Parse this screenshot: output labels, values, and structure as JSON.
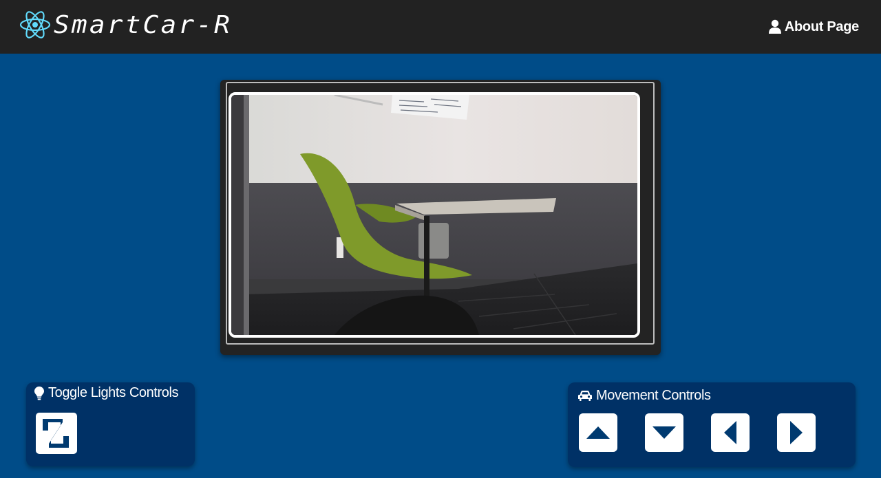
{
  "navbar": {
    "brand": "SmartCar-R",
    "about_label": "About Page",
    "brand_icon": "atom-icon",
    "about_icon": "user-icon"
  },
  "video": {
    "photo_icon": "camera-feed-image"
  },
  "lights": {
    "title": "Toggle Lights Controls",
    "title_icon": "lightbulb-icon",
    "button_icon": "z-logo-icon"
  },
  "movement": {
    "title": "Movement Controls",
    "title_icon": "car-icon",
    "buttons": [
      "forward",
      "backward",
      "left",
      "right"
    ]
  },
  "colors": {
    "background": "#004c88",
    "navbar": "#222222",
    "panel": "#003166",
    "icon_dark": "#003a70",
    "accent": "#61dafb"
  }
}
